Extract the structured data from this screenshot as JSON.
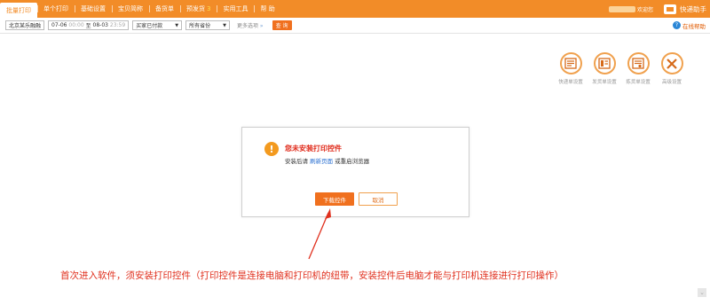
{
  "nav": {
    "tabs": [
      {
        "label": "批量打印"
      },
      {
        "label": "单个打印"
      },
      {
        "label": "基础设置"
      },
      {
        "label": "宝贝简称"
      },
      {
        "label": "备货单"
      },
      {
        "label": "预发货"
      },
      {
        "label": "实用工具"
      },
      {
        "label": "帮 助"
      }
    ],
    "prefab_count": "3",
    "user_suffix": "欢迎您",
    "helper_label": "快递助手"
  },
  "filter": {
    "shop": "北京某乐融融",
    "date_start": "07-06",
    "time_start": "00:00",
    "date_sep": "至",
    "date_end": "08-03",
    "time_end": "23:59",
    "status": "买家已付款",
    "region": "所有省份",
    "more": "更多选项",
    "more_arrow": "»",
    "query_label": "查 询",
    "online_help": "在线帮助",
    "online_help_icon": "?"
  },
  "tools": [
    {
      "label": "快递单设置",
      "icon": "express-sheet-icon"
    },
    {
      "label": "发货单设置",
      "icon": "invoice-sheet-icon"
    },
    {
      "label": "拣货单设置",
      "icon": "picking-sheet-icon"
    },
    {
      "label": "高级设置",
      "icon": "tools-icon"
    }
  ],
  "dialog": {
    "warn_icon": "!",
    "title": "您未安装打印控件",
    "text_before": "安装后请",
    "refresh_link": "刷新页面",
    "text_after": "或重启浏览器",
    "download_label": "下载控件",
    "cancel_label": "取消"
  },
  "annotation": "首次进入软件，须安装打印控件（打印控件是连接电脑和打印机的纽带，安装控件后电脑才能与打印机连接进行打印操作）",
  "colors": {
    "accent": "#f28c28",
    "button": "#f0701e",
    "warning_text": "#e0301e"
  }
}
